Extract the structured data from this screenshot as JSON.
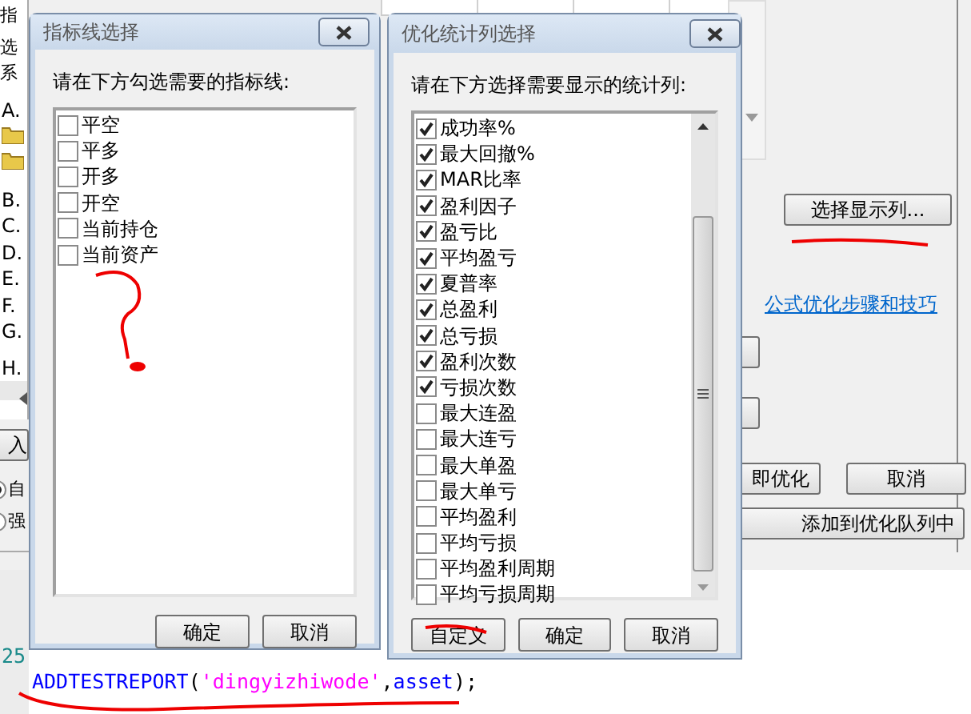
{
  "background_window": {
    "left_labels": [
      "指",
      "选",
      "系",
      "A.",
      "B.",
      "C.",
      "D.",
      "E.",
      "F.",
      "G.",
      "H."
    ],
    "import_button": "入",
    "radios": [
      {
        "label": "自",
        "selected": true
      },
      {
        "label": "强",
        "selected": false
      }
    ],
    "select_columns_button": "选择显示列...",
    "help_link": "公式优化步骤和技巧",
    "optimize_button": "即优化",
    "cancel_button": "取消",
    "queue_button": "添加到优化队列中",
    "editor": {
      "line_number": "25",
      "code": [
        {
          "kind": "ident",
          "text": "ADDTESTREPORT"
        },
        {
          "kind": "punct",
          "text": "("
        },
        {
          "kind": "string",
          "text": "'dingyizhiwode'"
        },
        {
          "kind": "punct",
          "text": ","
        },
        {
          "kind": "ident",
          "text": "asset"
        },
        {
          "kind": "punct",
          "text": ");"
        }
      ]
    }
  },
  "indicator_dialog": {
    "title": "指标线选择",
    "prompt": "请在下方勾选需要的指标线:",
    "items": [
      {
        "label": "平空",
        "checked": false
      },
      {
        "label": "平多",
        "checked": false
      },
      {
        "label": "开多",
        "checked": false
      },
      {
        "label": "开空",
        "checked": false
      },
      {
        "label": "当前持仓",
        "checked": false
      },
      {
        "label": "当前资产",
        "checked": false
      }
    ],
    "buttons": [
      "确定",
      "取消"
    ]
  },
  "stats_dialog": {
    "title": "优化统计列选择",
    "prompt": "请在下方选择需要显示的统计列:",
    "items": [
      {
        "label": "成功率%",
        "checked": true
      },
      {
        "label": "最大回撤%",
        "checked": true
      },
      {
        "label": "MAR比率",
        "checked": true
      },
      {
        "label": "盈利因子",
        "checked": true
      },
      {
        "label": "盈亏比",
        "checked": true
      },
      {
        "label": "平均盈亏",
        "checked": true
      },
      {
        "label": "夏普率",
        "checked": true
      },
      {
        "label": "总盈利",
        "checked": true
      },
      {
        "label": "总亏损",
        "checked": true
      },
      {
        "label": "盈利次数",
        "checked": true
      },
      {
        "label": "亏损次数",
        "checked": true
      },
      {
        "label": "最大连盈",
        "checked": false
      },
      {
        "label": "最大连亏",
        "checked": false
      },
      {
        "label": "最大单盈",
        "checked": false
      },
      {
        "label": "最大单亏",
        "checked": false
      },
      {
        "label": "平均盈利",
        "checked": false
      },
      {
        "label": "平均亏损",
        "checked": false
      },
      {
        "label": "平均盈利周期",
        "checked": false
      },
      {
        "label": "平均亏损周期",
        "checked": false
      }
    ],
    "buttons": [
      "自定义",
      "确定",
      "取消"
    ]
  }
}
